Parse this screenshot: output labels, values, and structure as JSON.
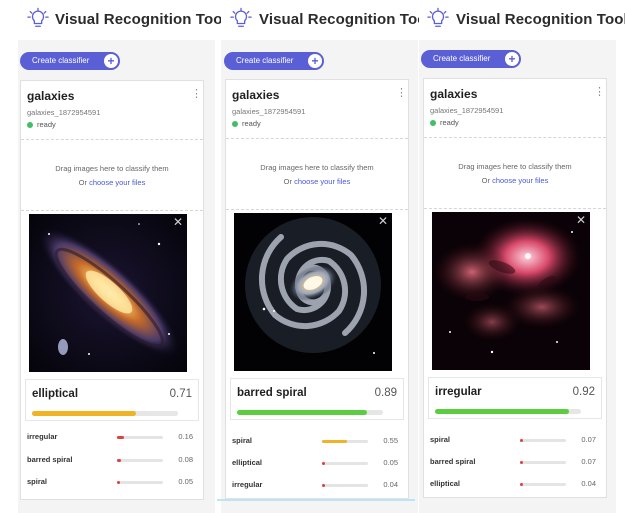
{
  "app_title": "Visual Recognition Tool",
  "create_button_label": "Create classifier",
  "colors": {
    "accent": "#5a5fd6",
    "ready_dot": "#42be65",
    "bar_orange": "#f0b323",
    "bar_green": "#5bce3f",
    "bar_red": "#e0403e",
    "link": "#4a58d8"
  },
  "icons": {
    "logo": "lightbulb-icon",
    "plus": "plus-circle-icon",
    "menu": "kebab-menu-icon",
    "close": "close-icon"
  },
  "panels": [
    {
      "classifier": {
        "name": "galaxies",
        "id": "galaxies_1872954591",
        "status": "ready"
      },
      "dropzone": {
        "text": "Drag images here to classify them",
        "or": "Or",
        "link": "choose your files"
      },
      "image_subject": "elliptical-galaxy-image",
      "top": {
        "label": "elliptical",
        "score": "0.71",
        "value": 0.71,
        "color": "#f0b323"
      },
      "others": [
        {
          "label": "irregular",
          "score": "0.16",
          "value": 0.16,
          "color": "#e0403e"
        },
        {
          "label": "barred spiral",
          "score": "0.08",
          "value": 0.08,
          "color": "#e0403e"
        },
        {
          "label": "spiral",
          "score": "0.05",
          "value": 0.05,
          "color": "#e0403e"
        }
      ]
    },
    {
      "classifier": {
        "name": "galaxies",
        "id": "galaxies_1872954591",
        "status": "ready"
      },
      "dropzone": {
        "text": "Drag images here to classify them",
        "or": "Or",
        "link": "choose your files"
      },
      "image_subject": "barred-spiral-galaxy-image",
      "top": {
        "label": "barred spiral",
        "score": "0.89",
        "value": 0.89,
        "color": "#5bce3f"
      },
      "others": [
        {
          "label": "spiral",
          "score": "0.55",
          "value": 0.55,
          "color": "#f0b323"
        },
        {
          "label": "elliptical",
          "score": "0.05",
          "value": 0.05,
          "color": "#e0403e"
        },
        {
          "label": "irregular",
          "score": "0.04",
          "value": 0.04,
          "color": "#e0403e"
        }
      ]
    },
    {
      "classifier": {
        "name": "galaxies",
        "id": "galaxies_1872954591",
        "status": "ready"
      },
      "dropzone": {
        "text": "Drag images here to classify them",
        "or": "Or",
        "link": "choose your files"
      },
      "image_subject": "irregular-galaxy-image",
      "top": {
        "label": "irregular",
        "score": "0.92",
        "value": 0.92,
        "color": "#5bce3f"
      },
      "others": [
        {
          "label": "spiral",
          "score": "0.07",
          "value": 0.07,
          "color": "#e0403e"
        },
        {
          "label": "barred spiral",
          "score": "0.07",
          "value": 0.07,
          "color": "#e0403e"
        },
        {
          "label": "elliptical",
          "score": "0.04",
          "value": 0.04,
          "color": "#e0403e"
        }
      ]
    }
  ]
}
